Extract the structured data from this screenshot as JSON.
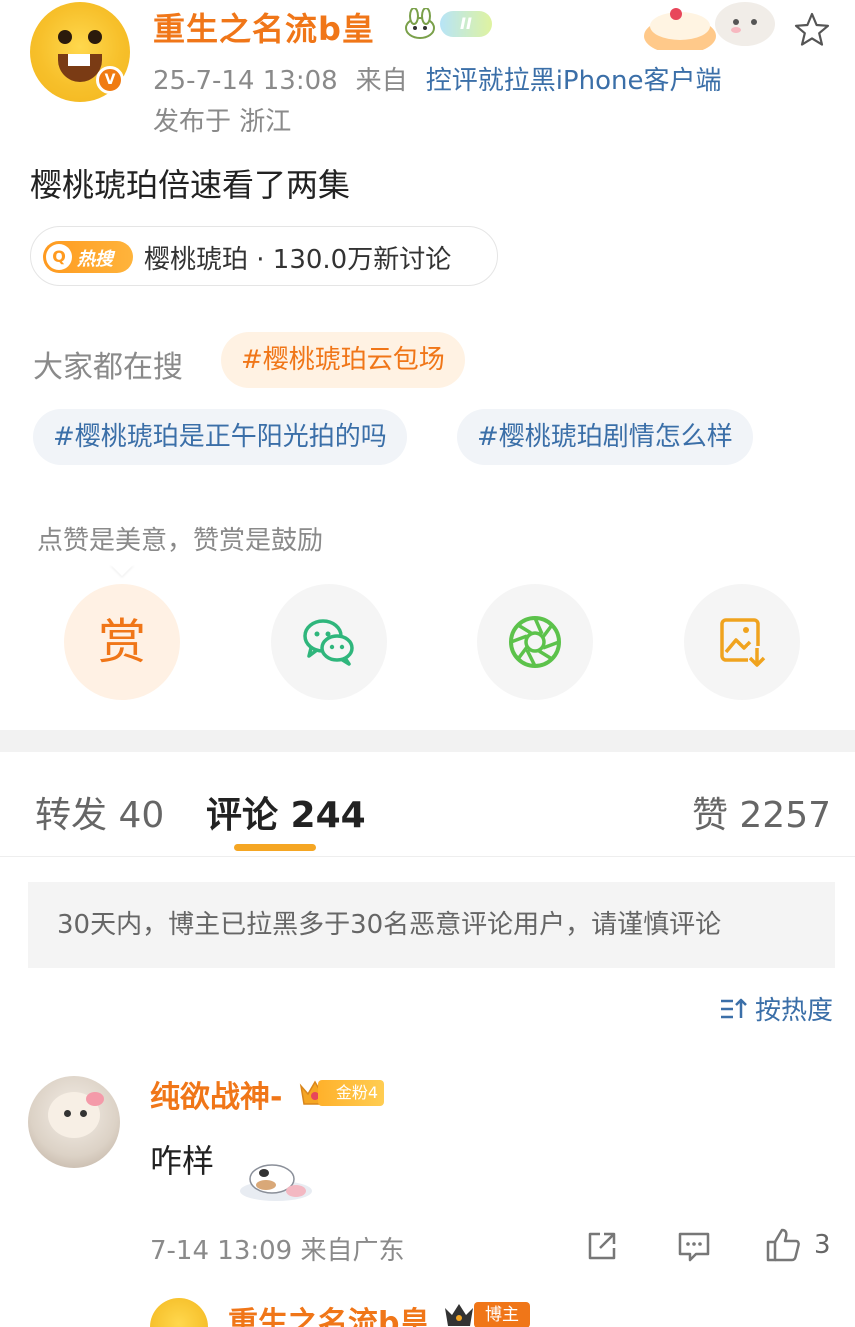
{
  "post": {
    "username": "重生之名流b皇",
    "level_badge": "II",
    "time": "25-7-14 13:08",
    "source_prefix": "来自",
    "source": "控评就拉黑iPhone客户端",
    "location": "发布于 浙江",
    "verified_mark": "V",
    "text": "樱桃琥珀倍速看了两集"
  },
  "hot_search": {
    "tag_icon": "Q",
    "tag_label": "热搜",
    "text": "樱桃琥珀 · 130.0万新讨论"
  },
  "everyone_searching": {
    "label": "大家都在搜",
    "chips": [
      "#樱桃琥珀云包场",
      "#樱桃琥珀是正午阳光拍的吗",
      "#樱桃琥珀剧情怎么样"
    ]
  },
  "reward": {
    "text": "点赞是美意，赞赏是鼓励",
    "reward_char": "赏",
    "buttons": [
      "reward-icon",
      "wechat-icon",
      "moments-icon",
      "save-image-icon"
    ]
  },
  "tabs": {
    "repost": "转发 40",
    "comments": "评论 244",
    "likes": "赞 2257"
  },
  "notice": "30天内，博主已拉黑多于30名恶意评论用户，请谨慎评论",
  "sort": {
    "label": "按热度"
  },
  "comment": {
    "username": "纯欲战神-",
    "fan_badge": "金粉4",
    "text": "咋样",
    "meta": "7-14 13:09 来自广东",
    "like_count": "3"
  },
  "reply": {
    "username": "重生之名流b皇",
    "badge": "博主"
  },
  "colors": {
    "accent_orange": "#f07618",
    "link_blue": "#3b6fa8",
    "muted_gray": "#8a8a8a",
    "tab_underline": "#f5a623"
  }
}
